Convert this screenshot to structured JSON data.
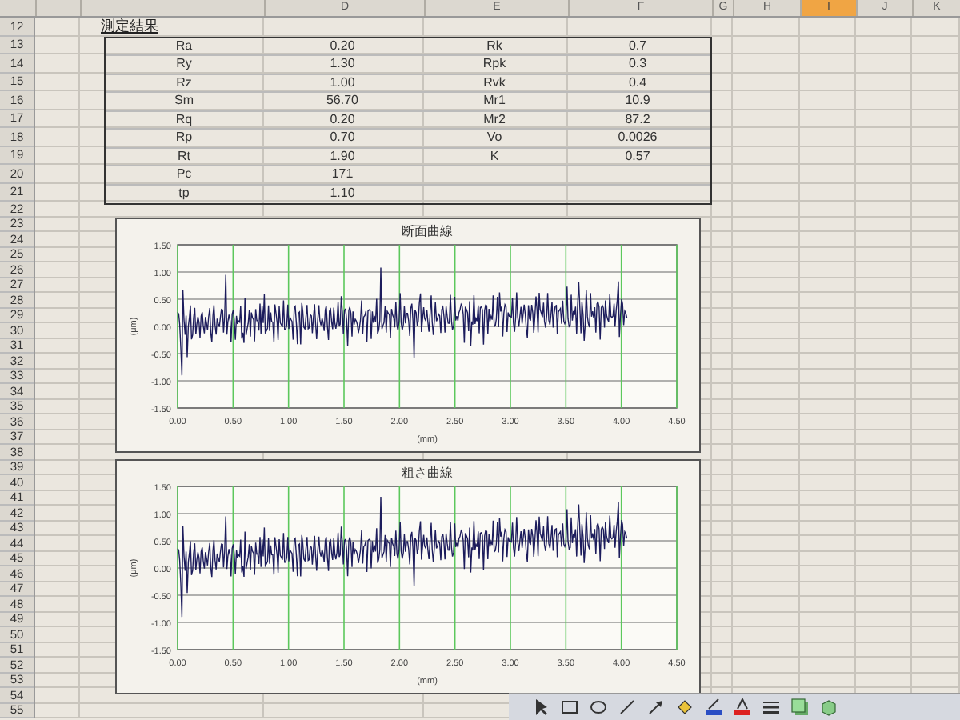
{
  "sheet": {
    "columns": [
      {
        "selected": false
      },
      {
        "selected": false
      },
      {
        "label": "D",
        "selected": false
      },
      {
        "label": "E",
        "selected": false
      },
      {
        "label": "F",
        "selected": false
      },
      {
        "label": "G",
        "selected": false
      },
      {
        "label": "H",
        "selected": false
      },
      {
        "label": "I",
        "selected": true
      },
      {
        "label": "J",
        "selected": false
      },
      {
        "label": "K",
        "selected": false
      }
    ],
    "rows": [
      "12",
      "13",
      "14",
      "15",
      "16",
      "17",
      "18",
      "19",
      "20",
      "21",
      "22",
      "23",
      "24",
      "25",
      "26",
      "27",
      "28",
      "29",
      "30",
      "31",
      "32",
      "33",
      "34",
      "35",
      "36",
      "37",
      "38",
      "39",
      "40",
      "41",
      "42",
      "43",
      "44",
      "45",
      "46",
      "47",
      "48",
      "49",
      "50",
      "51",
      "52",
      "53",
      "54",
      "55"
    ]
  },
  "results": {
    "title": "測定結果",
    "left": [
      {
        "name": "Ra",
        "value": "0.20"
      },
      {
        "name": "Ry",
        "value": "1.30"
      },
      {
        "name": "Rz",
        "value": "1.00"
      },
      {
        "name": "Sm",
        "value": "56.70"
      },
      {
        "name": "Rq",
        "value": "0.20"
      },
      {
        "name": "Rp",
        "value": "0.70"
      },
      {
        "name": "Rt",
        "value": "1.90"
      },
      {
        "name": "Pc",
        "value": "171"
      },
      {
        "name": "tp",
        "value": "1.10"
      }
    ],
    "right": [
      {
        "name": "Rk",
        "value": "0.7"
      },
      {
        "name": "Rpk",
        "value": "0.3"
      },
      {
        "name": "Rvk",
        "value": "0.4"
      },
      {
        "name": "Mr1",
        "value": "10.9"
      },
      {
        "name": "Mr2",
        "value": "87.2"
      },
      {
        "name": "Vo",
        "value": "0.0026"
      },
      {
        "name": "K",
        "value": "0.57"
      }
    ]
  },
  "charts": [
    {
      "title": "断面曲線",
      "y_axis_label": "(μm)",
      "x_axis_label": "(mm)",
      "y_tick_labels": [
        "1.50",
        "1.00",
        "0.50",
        "0.00",
        "-0.50",
        "-1.00",
        "-1.50"
      ],
      "x_tick_labels": [
        "0.00",
        "0.50",
        "1.00",
        "1.50",
        "2.00",
        "2.50",
        "3.00",
        "3.50",
        "4.00",
        "4.50"
      ]
    },
    {
      "title": "粗さ曲線",
      "y_axis_label": "(μm)",
      "x_axis_label": "(mm)",
      "y_tick_labels": [
        "1.50",
        "1.00",
        "0.50",
        "0.00",
        "-0.50",
        "-1.00",
        "-1.50"
      ],
      "x_tick_labels": [
        "0.00",
        "0.50",
        "1.00",
        "1.50",
        "2.00",
        "2.50",
        "3.00",
        "3.50",
        "4.00",
        "4.50"
      ]
    }
  ]
}
